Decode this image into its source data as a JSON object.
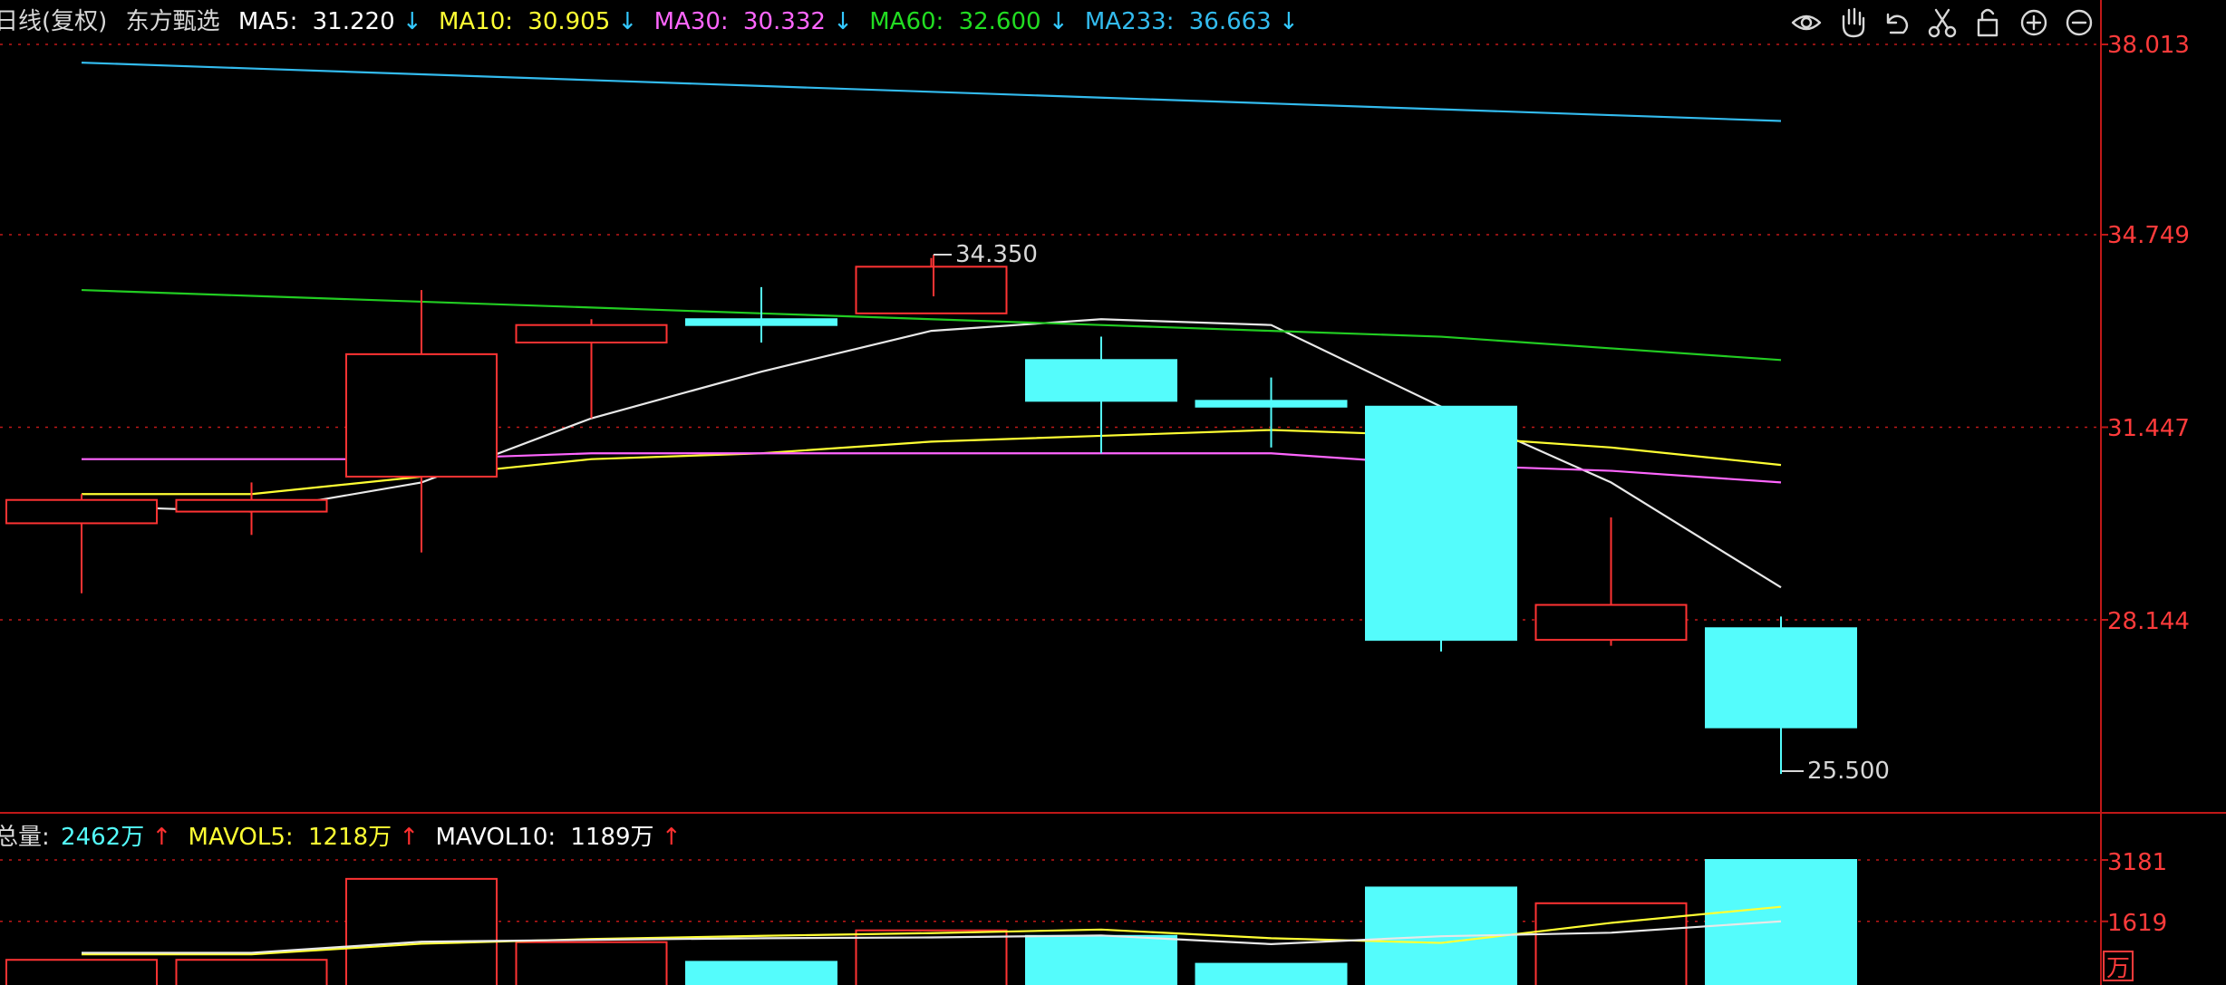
{
  "colors": {
    "background": "#000000",
    "grid": "#c01818",
    "up": "#ff3333",
    "down": "#54fcfc",
    "doji": "#54fcfc",
    "white": "#e8e8e8",
    "yellow": "#ffff33",
    "magenta": "#ff66ff",
    "green": "#22cc22",
    "cyan": "#33bbee",
    "axis_text": "#ff3b3b",
    "arrow_down": "#33c8ff",
    "arrow_up": "#ff3030",
    "neutral_text": "#d8d8d8"
  },
  "header": {
    "period": "日线(复权)",
    "stock": "东方甄选",
    "ma": [
      {
        "label": "MA5:",
        "value": "31.220",
        "arrow": "↓",
        "color": "#ffffff"
      },
      {
        "label": "MA10:",
        "value": "30.905",
        "arrow": "↓",
        "color": "#ffff33"
      },
      {
        "label": "MA30:",
        "value": "30.332",
        "arrow": "↓",
        "color": "#ff66ff"
      },
      {
        "label": "MA60:",
        "value": "32.600",
        "arrow": "↓",
        "color": "#22dd22"
      },
      {
        "label": "MA233:",
        "value": "36.663",
        "arrow": "↓",
        "color": "#33bbee"
      }
    ]
  },
  "toolbar": {
    "icons": [
      "eye-icon",
      "hand-icon",
      "undo-icon",
      "scissors-icon",
      "lock-icon",
      "zoom-in-icon",
      "zoom-out-icon"
    ]
  },
  "volume_header": {
    "total_label": "总量:",
    "total_value": "2462万",
    "total_arrow": "↑",
    "mavol5_label": "MAVOL5:",
    "mavol5_value": "1218万",
    "mavol5_arrow": "↑",
    "mavol10_label": "MAVOL10:",
    "mavol10_value": "1189万",
    "mavol10_arrow": "↑"
  },
  "price_axis_labels": [
    "38.013",
    "34.749",
    "31.447",
    "28.144"
  ],
  "volume_axis_labels": [
    "3181",
    "1619"
  ],
  "volume_unit": "万",
  "annotations": {
    "high": "34.350",
    "low": "25.500"
  },
  "chart_data": [
    {
      "type": "candlestick",
      "title": "日线(复权) 东方甄选",
      "ylim": [
        24.6,
        38.6
      ],
      "grid": true,
      "candles": [
        {
          "open": 29.8,
          "high": 30.3,
          "low": 28.6,
          "close": 30.2
        },
        {
          "open": 30.0,
          "high": 30.5,
          "low": 29.6,
          "close": 30.2
        },
        {
          "open": 30.6,
          "high": 33.8,
          "low": 29.3,
          "close": 32.7
        },
        {
          "open": 32.9,
          "high": 33.3,
          "low": 31.6,
          "close": 33.2
        },
        {
          "open": 33.3,
          "high": 33.85,
          "low": 32.9,
          "close": 33.2
        },
        {
          "open": 33.4,
          "high": 34.35,
          "low": 33.4,
          "close": 34.2
        },
        {
          "open": 32.6,
          "high": 33.0,
          "low": 31.0,
          "close": 31.9
        },
        {
          "open": 31.9,
          "high": 32.3,
          "low": 31.1,
          "close": 31.8
        },
        {
          "open": 31.8,
          "high": 31.8,
          "low": 27.6,
          "close": 27.8
        },
        {
          "open": 27.8,
          "high": 29.9,
          "low": 27.7,
          "close": 28.4
        },
        {
          "open": 28.0,
          "high": 28.2,
          "low": 25.5,
          "close": 26.3
        }
      ],
      "series": [
        {
          "name": "MA5",
          "color": "#e8e8e8",
          "values": [
            30.1,
            30.0,
            30.5,
            31.6,
            32.4,
            33.1,
            33.3,
            33.2,
            31.8,
            30.5,
            28.7
          ]
        },
        {
          "name": "MA10",
          "color": "#ffff33",
          "values": [
            30.3,
            30.3,
            30.6,
            30.9,
            31.0,
            31.2,
            31.3,
            31.4,
            31.3,
            31.1,
            30.8
          ]
        },
        {
          "name": "MA30",
          "color": "#ff66ff",
          "values": [
            30.9,
            30.9,
            30.9,
            31.0,
            31.0,
            31.0,
            31.0,
            31.0,
            30.8,
            30.7,
            30.5
          ]
        },
        {
          "name": "MA60",
          "color": "#22cc22",
          "values": [
            33.8,
            33.7,
            33.6,
            33.5,
            33.4,
            33.3,
            33.2,
            33.1,
            33.0,
            32.8,
            32.6
          ]
        },
        {
          "name": "MA233",
          "color": "#33bbee",
          "values": [
            37.7,
            37.6,
            37.5,
            37.4,
            37.3,
            37.2,
            37.1,
            37.0,
            36.9,
            36.8,
            36.7
          ]
        }
      ]
    },
    {
      "type": "bar",
      "title": "总量",
      "ylim": [
        0,
        3350
      ],
      "values": [
        640,
        640,
        2700,
        1090,
        590,
        1390,
        1250,
        540,
        2480,
        2080,
        3181
      ],
      "series": [
        {
          "name": "MAVOL5",
          "color": "#ffff33",
          "values": [
            780,
            780,
            1050,
            1170,
            1250,
            1320,
            1410,
            1190,
            1070,
            1580,
            1990
          ]
        },
        {
          "name": "MAVOL10",
          "color": "#e8e8e8",
          "values": [
            820,
            820,
            1100,
            1150,
            1190,
            1210,
            1260,
            1040,
            1240,
            1330,
            1619
          ]
        }
      ]
    }
  ]
}
